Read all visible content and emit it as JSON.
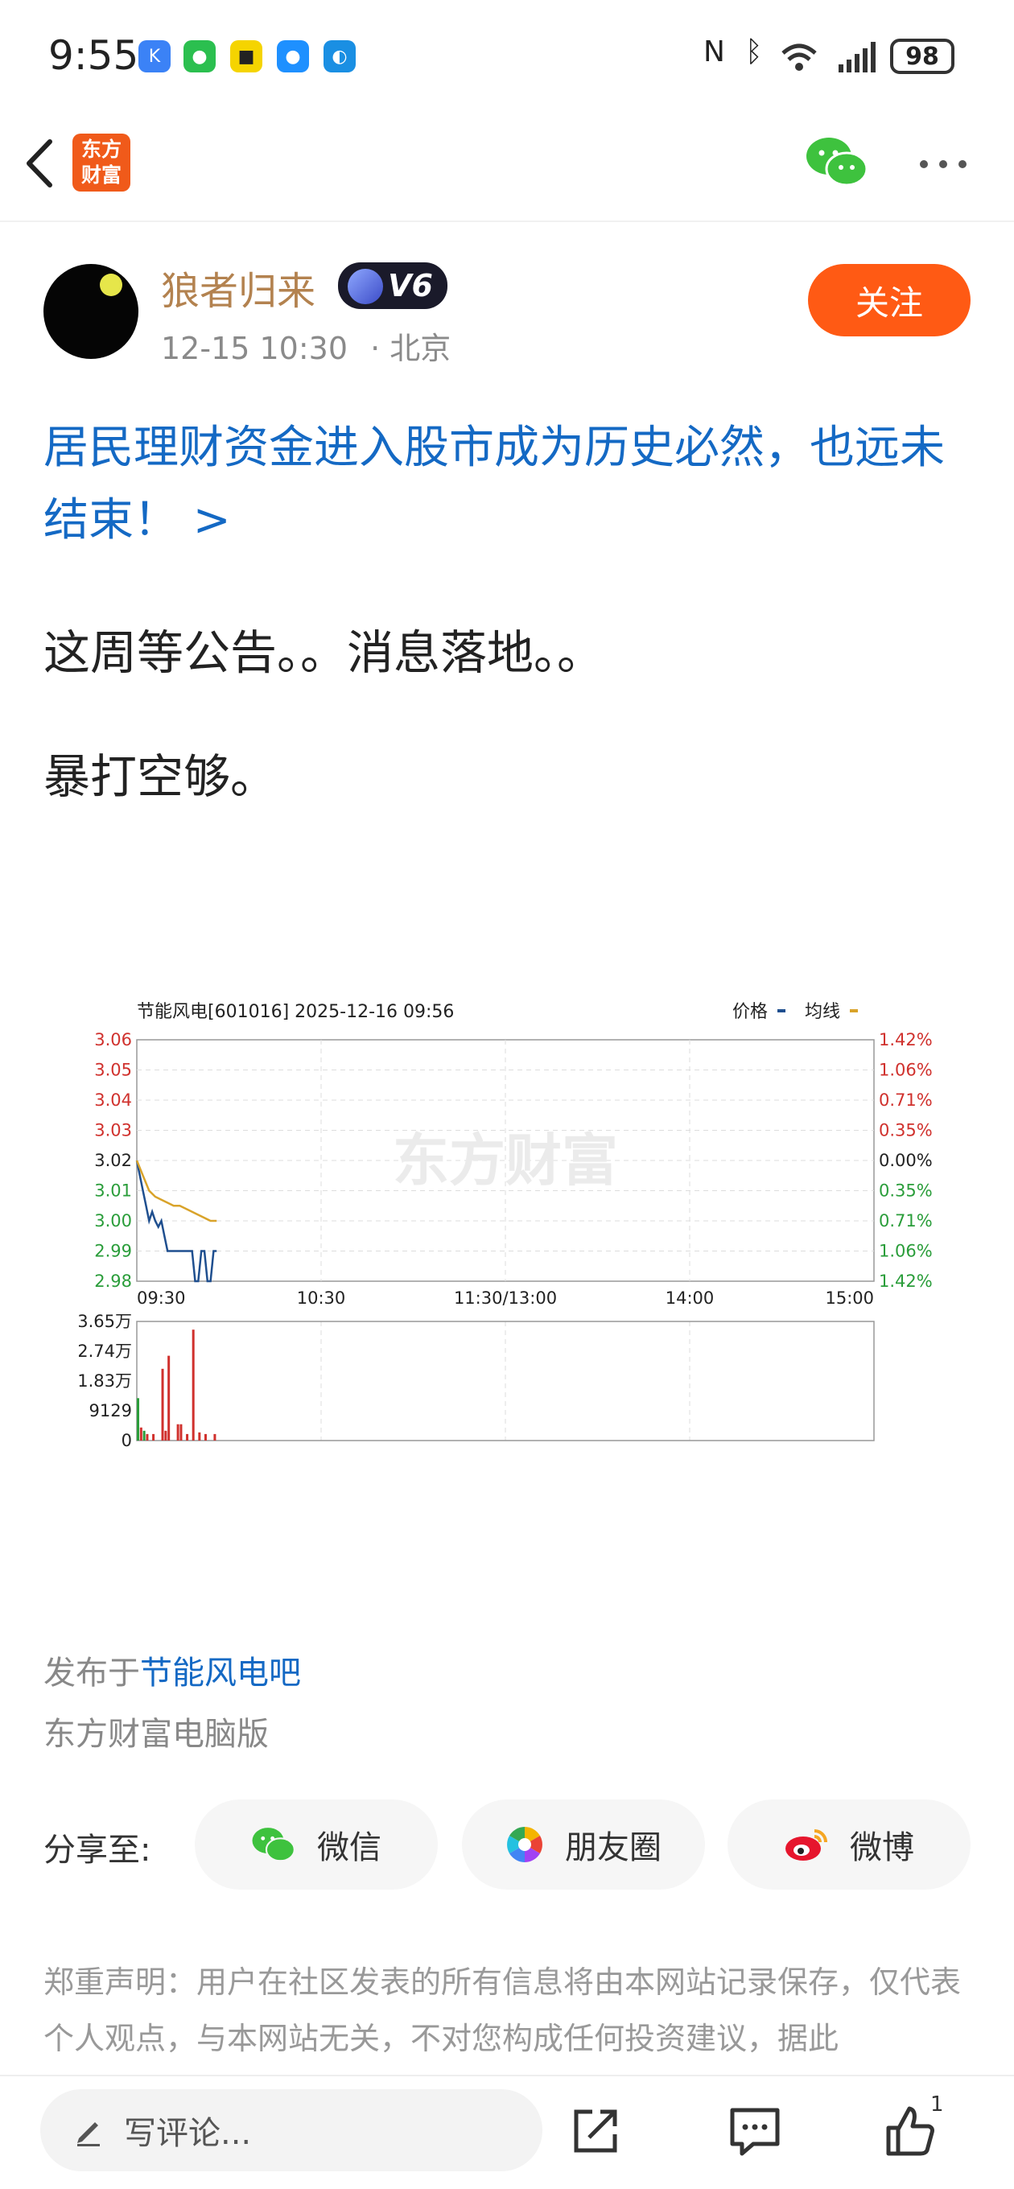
{
  "status_bar": {
    "time": "9:55",
    "battery": "98"
  },
  "nav": {
    "logo_line1": "东方",
    "logo_line2": "财富"
  },
  "author": {
    "name": "狼者归来",
    "level": "V6",
    "date": "12-15 10:30",
    "location": "· 北京",
    "follow_label": "关注"
  },
  "post": {
    "topic": "居民理财资金进入股市成为历史必然，也远未结束！ >",
    "lines": [
      "这周等公告。。消息落地。。",
      "暴打空够。"
    ]
  },
  "chart_data": {
    "type": "line",
    "title": "节能风电[601016] 2025-12-16 09:56",
    "legend": [
      {
        "name": "价格",
        "color": "#1f4f8f"
      },
      {
        "name": "均线",
        "color": "#d9a32a"
      }
    ],
    "watermark": "东方财富",
    "x_ticks": [
      "09:30",
      "10:30",
      "11:30/13:00",
      "14:00",
      "15:00"
    ],
    "y_ticks_left": [
      "3.06",
      "3.05",
      "3.04",
      "3.03",
      "3.02",
      "3.01",
      "3.00",
      "2.99",
      "2.98"
    ],
    "y_ticks_right": [
      "1.42%",
      "1.06%",
      "0.71%",
      "0.35%",
      "0.00%",
      "0.35%",
      "0.71%",
      "1.06%",
      "1.42%"
    ],
    "ylim": [
      2.98,
      3.06
    ],
    "x_minutes_total": 240,
    "series": [
      {
        "name": "价格",
        "color": "#1f4f8f",
        "x": [
          0,
          1,
          2,
          3,
          4,
          5,
          6,
          7,
          8,
          9,
          10,
          11,
          12,
          13,
          14,
          15,
          16,
          17,
          18,
          19,
          20,
          21,
          22,
          23,
          24,
          25,
          26
        ],
        "values": [
          3.02,
          3.015,
          3.01,
          3.005,
          3.0,
          3.003,
          3.0,
          2.998,
          3.0,
          2.995,
          2.99,
          2.99,
          2.99,
          2.99,
          2.99,
          2.99,
          2.99,
          2.99,
          2.99,
          2.98,
          2.98,
          2.99,
          2.99,
          2.98,
          2.98,
          2.99,
          2.99
        ]
      },
      {
        "name": "均线",
        "color": "#d9a32a",
        "x": [
          0,
          2,
          4,
          6,
          8,
          10,
          12,
          14,
          16,
          18,
          20,
          22,
          24,
          26
        ],
        "values": [
          3.02,
          3.015,
          3.01,
          3.008,
          3.007,
          3.006,
          3.005,
          3.005,
          3.004,
          3.003,
          3.002,
          3.001,
          3.0,
          3.0
        ]
      }
    ],
    "volume": {
      "y_ticks": [
        "3.65万",
        "2.74万",
        "1.83万",
        "9129",
        "0"
      ],
      "ymax": 36516,
      "x": [
        0,
        1,
        2,
        3,
        5,
        8,
        9,
        10,
        13,
        14,
        16,
        18,
        20,
        22,
        25
      ],
      "values": [
        13000,
        4000,
        3000,
        2000,
        2000,
        22000,
        3000,
        26000,
        5000,
        5000,
        2000,
        34000,
        2500,
        2000,
        2000
      ],
      "up_color": "#d0312d",
      "down_color": "#2a9d3a",
      "colors": [
        "d",
        "u",
        "d",
        "u",
        "u",
        "u",
        "u",
        "u",
        "u",
        "u",
        "u",
        "u",
        "u",
        "u",
        "u"
      ]
    }
  },
  "footer": {
    "posted_prefix": "发布于",
    "posted_bar": "节能风电吧",
    "platform": "东方财富电脑版",
    "share_label": "分享至:",
    "share": [
      "微信",
      "朋友圈",
      "微博"
    ],
    "disclaimer": "郑重声明：用户在社区发表的所有信息将由本网站记录保存，仅代表个人观点，与本网站无关，不对您构成任何投资建议，据此"
  },
  "bottom_bar": {
    "comment_placeholder": "写评论...",
    "like_count": "1"
  }
}
